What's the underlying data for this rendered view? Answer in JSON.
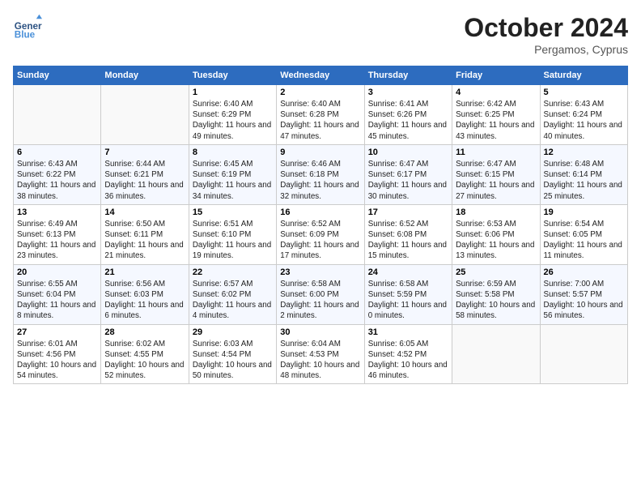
{
  "header": {
    "logo_line1": "General",
    "logo_line2": "Blue",
    "month": "October 2024",
    "location": "Pergamos, Cyprus"
  },
  "days_of_week": [
    "Sunday",
    "Monday",
    "Tuesday",
    "Wednesday",
    "Thursday",
    "Friday",
    "Saturday"
  ],
  "weeks": [
    [
      {
        "day": "",
        "text": ""
      },
      {
        "day": "",
        "text": ""
      },
      {
        "day": "1",
        "text": "Sunrise: 6:40 AM\nSunset: 6:29 PM\nDaylight: 11 hours and 49 minutes."
      },
      {
        "day": "2",
        "text": "Sunrise: 6:40 AM\nSunset: 6:28 PM\nDaylight: 11 hours and 47 minutes."
      },
      {
        "day": "3",
        "text": "Sunrise: 6:41 AM\nSunset: 6:26 PM\nDaylight: 11 hours and 45 minutes."
      },
      {
        "day": "4",
        "text": "Sunrise: 6:42 AM\nSunset: 6:25 PM\nDaylight: 11 hours and 43 minutes."
      },
      {
        "day": "5",
        "text": "Sunrise: 6:43 AM\nSunset: 6:24 PM\nDaylight: 11 hours and 40 minutes."
      }
    ],
    [
      {
        "day": "6",
        "text": "Sunrise: 6:43 AM\nSunset: 6:22 PM\nDaylight: 11 hours and 38 minutes."
      },
      {
        "day": "7",
        "text": "Sunrise: 6:44 AM\nSunset: 6:21 PM\nDaylight: 11 hours and 36 minutes."
      },
      {
        "day": "8",
        "text": "Sunrise: 6:45 AM\nSunset: 6:19 PM\nDaylight: 11 hours and 34 minutes."
      },
      {
        "day": "9",
        "text": "Sunrise: 6:46 AM\nSunset: 6:18 PM\nDaylight: 11 hours and 32 minutes."
      },
      {
        "day": "10",
        "text": "Sunrise: 6:47 AM\nSunset: 6:17 PM\nDaylight: 11 hours and 30 minutes."
      },
      {
        "day": "11",
        "text": "Sunrise: 6:47 AM\nSunset: 6:15 PM\nDaylight: 11 hours and 27 minutes."
      },
      {
        "day": "12",
        "text": "Sunrise: 6:48 AM\nSunset: 6:14 PM\nDaylight: 11 hours and 25 minutes."
      }
    ],
    [
      {
        "day": "13",
        "text": "Sunrise: 6:49 AM\nSunset: 6:13 PM\nDaylight: 11 hours and 23 minutes."
      },
      {
        "day": "14",
        "text": "Sunrise: 6:50 AM\nSunset: 6:11 PM\nDaylight: 11 hours and 21 minutes."
      },
      {
        "day": "15",
        "text": "Sunrise: 6:51 AM\nSunset: 6:10 PM\nDaylight: 11 hours and 19 minutes."
      },
      {
        "day": "16",
        "text": "Sunrise: 6:52 AM\nSunset: 6:09 PM\nDaylight: 11 hours and 17 minutes."
      },
      {
        "day": "17",
        "text": "Sunrise: 6:52 AM\nSunset: 6:08 PM\nDaylight: 11 hours and 15 minutes."
      },
      {
        "day": "18",
        "text": "Sunrise: 6:53 AM\nSunset: 6:06 PM\nDaylight: 11 hours and 13 minutes."
      },
      {
        "day": "19",
        "text": "Sunrise: 6:54 AM\nSunset: 6:05 PM\nDaylight: 11 hours and 11 minutes."
      }
    ],
    [
      {
        "day": "20",
        "text": "Sunrise: 6:55 AM\nSunset: 6:04 PM\nDaylight: 11 hours and 8 minutes."
      },
      {
        "day": "21",
        "text": "Sunrise: 6:56 AM\nSunset: 6:03 PM\nDaylight: 11 hours and 6 minutes."
      },
      {
        "day": "22",
        "text": "Sunrise: 6:57 AM\nSunset: 6:02 PM\nDaylight: 11 hours and 4 minutes."
      },
      {
        "day": "23",
        "text": "Sunrise: 6:58 AM\nSunset: 6:00 PM\nDaylight: 11 hours and 2 minutes."
      },
      {
        "day": "24",
        "text": "Sunrise: 6:58 AM\nSunset: 5:59 PM\nDaylight: 11 hours and 0 minutes."
      },
      {
        "day": "25",
        "text": "Sunrise: 6:59 AM\nSunset: 5:58 PM\nDaylight: 10 hours and 58 minutes."
      },
      {
        "day": "26",
        "text": "Sunrise: 7:00 AM\nSunset: 5:57 PM\nDaylight: 10 hours and 56 minutes."
      }
    ],
    [
      {
        "day": "27",
        "text": "Sunrise: 6:01 AM\nSunset: 4:56 PM\nDaylight: 10 hours and 54 minutes."
      },
      {
        "day": "28",
        "text": "Sunrise: 6:02 AM\nSunset: 4:55 PM\nDaylight: 10 hours and 52 minutes."
      },
      {
        "day": "29",
        "text": "Sunrise: 6:03 AM\nSunset: 4:54 PM\nDaylight: 10 hours and 50 minutes."
      },
      {
        "day": "30",
        "text": "Sunrise: 6:04 AM\nSunset: 4:53 PM\nDaylight: 10 hours and 48 minutes."
      },
      {
        "day": "31",
        "text": "Sunrise: 6:05 AM\nSunset: 4:52 PM\nDaylight: 10 hours and 46 minutes."
      },
      {
        "day": "",
        "text": ""
      },
      {
        "day": "",
        "text": ""
      }
    ]
  ]
}
